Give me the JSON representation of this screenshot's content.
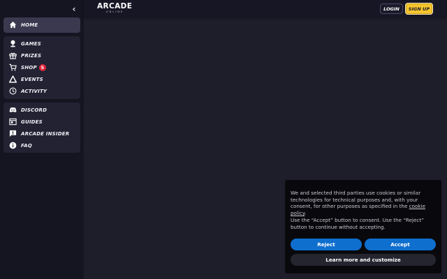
{
  "sidebar": {
    "collapse_icon": "chevron-left-icon",
    "home": {
      "label": "HOME",
      "icon": "home-icon"
    },
    "main_items": [
      {
        "label": "GAMES",
        "icon": "joystick-icon"
      },
      {
        "label": "PRIZES",
        "icon": "gift-icon"
      },
      {
        "label": "SHOP",
        "icon": "cart-icon",
        "badge": "5"
      },
      {
        "label": "EVENTS",
        "icon": "triangle-icon"
      },
      {
        "label": "ACTIVITY",
        "icon": "clock-icon"
      }
    ],
    "secondary_items": [
      {
        "label": "DISCORD",
        "icon": "discord-icon"
      },
      {
        "label": "GUIDES",
        "icon": "guide-icon"
      },
      {
        "label": "ARCADE INSIDER",
        "icon": "alert-chat-icon"
      },
      {
        "label": "FAQ",
        "icon": "info-icon"
      }
    ]
  },
  "header": {
    "logo_main": "ARCADE",
    "logo_sub": "ONLINE",
    "login_label": "LOGIN",
    "signup_label": "SIGN UP"
  },
  "cookie_banner": {
    "text_part1": "We and selected third parties use cookies or similar technologies for technical purposes and, with your consent, for other purposes as specified in the ",
    "link_text": "cookie policy",
    "text_part2": ".",
    "text_part3": "Use the “Accept” button to consent. Use the “Reject” button to continue without accepting.",
    "reject_label": "Reject",
    "accept_label": "Accept",
    "learn_label": "Learn more and customize"
  },
  "colors": {
    "background": "#1e1d2a",
    "sidebar": "#151421",
    "accent_yellow": "#f8c62c",
    "badge_red": "#e0263c",
    "button_blue": "#0f6fcf"
  }
}
